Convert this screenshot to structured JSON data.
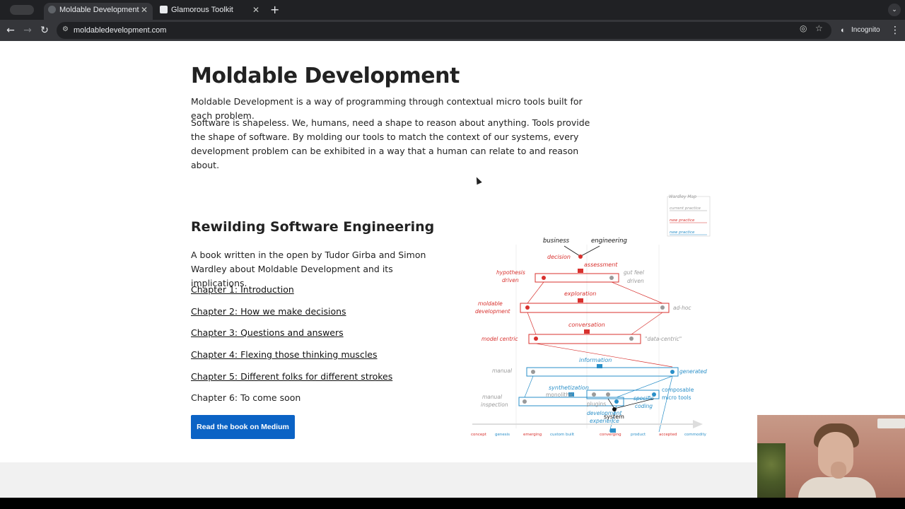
{
  "browser": {
    "tabs": [
      {
        "title": "Moldable Development",
        "active": true
      },
      {
        "title": "Glamorous Toolkit",
        "active": false
      }
    ],
    "url": "moldabledevelopment.com",
    "incognito_label": "Incognito"
  },
  "page": {
    "title": "Moldable Development",
    "intro": "Moldable Development is a way of programming through contextual micro tools built for each problem.",
    "paragraph": "Software is shapeless. We, humans, need a shape to reason about anything. Tools provide the shape of software. By molding our tools to match the context of our systems, every development problem can be exhibited in a way that a human can relate to and reason about.",
    "book": {
      "heading": "Rewilding Software Engineering",
      "description": "A book written in the open by Tudor Girba and Simon Wardley about Moldable Development and its implications.",
      "chapters": [
        {
          "label": "Chapter 1: Introduction",
          "link": true
        },
        {
          "label": "Chapter 2: How we make decisions",
          "link": true
        },
        {
          "label": "Chapter 3: Questions and answers",
          "link": true
        },
        {
          "label": "Chapter 4: Flexing those thinking muscles",
          "link": true
        },
        {
          "label": "Chapter 5: Different folks for different strokes",
          "link": true
        },
        {
          "label": "Chapter 6: To come soon",
          "link": false
        }
      ],
      "cta_label": "Read the book on Medium"
    }
  },
  "diagram": {
    "top_labels": [
      "business",
      "engineering"
    ],
    "legend": {
      "title": "Wardley Map",
      "items": [
        "current practice",
        "new practice",
        "new practice"
      ]
    },
    "red_labels": [
      "decision",
      "assessment",
      "hypothesis driven",
      "exploration",
      "moldable development",
      "conversation",
      "model centric"
    ],
    "gray_labels": [
      "gut feel driven",
      "ad-hoc",
      "\"data-centric\"",
      "manual",
      "manual inspection",
      "monolithic",
      "plugins"
    ],
    "blue_labels": [
      "information",
      "generated",
      "synthetization",
      "specific coding",
      "development experience",
      "composable micro tools"
    ],
    "bottom_label": "system",
    "axis": [
      "concept",
      "genesis",
      "emerging",
      "custom built",
      "converging",
      "product",
      "accepted",
      "commodity"
    ],
    "colors": {
      "red": "#d8312e",
      "blue": "#2a8fc8",
      "gray": "#9a9a9a"
    }
  }
}
